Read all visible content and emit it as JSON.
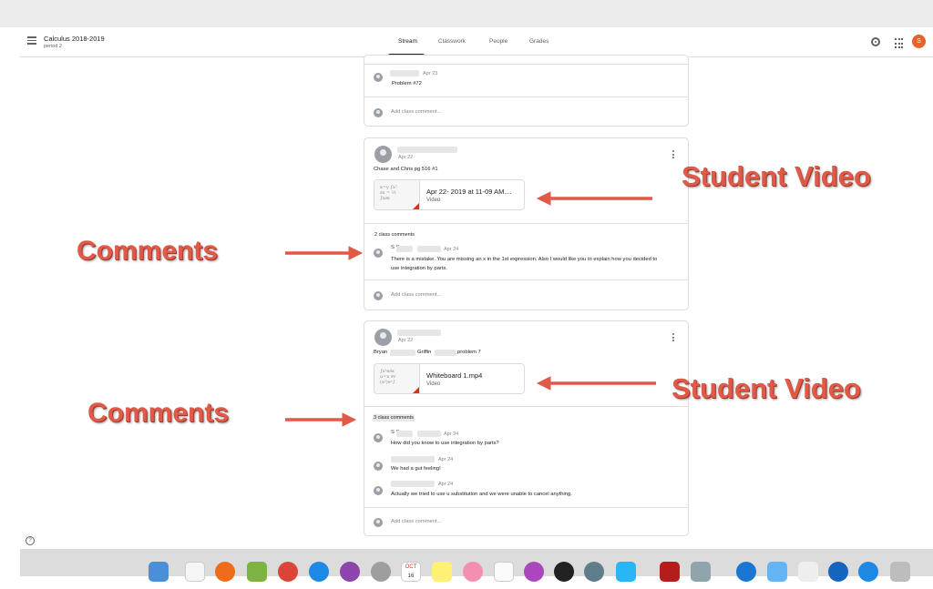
{
  "header": {
    "class_title": "Calculus 2018-2019",
    "class_subtitle": "period 2",
    "tabs": [
      {
        "label": "Stream",
        "active": true
      },
      {
        "label": "Classwork",
        "active": false
      },
      {
        "label": "People",
        "active": false
      },
      {
        "label": "Grades",
        "active": false
      }
    ],
    "avatar_letter": "S"
  },
  "card_top": {
    "comment_date": "Apr 23",
    "comment_text": "Problem #72",
    "add_comment_placeholder": "Add class comment..."
  },
  "post1": {
    "date": "Apr 22",
    "body": "Chase and Chris pg 516 #1",
    "attachment_title": "Apr 22- 2019 at 11-09 AM....",
    "attachment_type": "Video",
    "comment_count": "2 class comments",
    "comments": [
      {
        "author": "S          S",
        "date": "Apr 24",
        "text_line1": "There is a mistake. You are missing an x in the 1st expression. Also I would like you to explain how you decided to",
        "text_line2": "use integration by parts."
      }
    ],
    "add_comment_placeholder": "Add class comment..."
  },
  "post2": {
    "date": "Apr 22",
    "body_prefix": "Bryan",
    "body_middle": "Griffin",
    "body_suffix": "problem 7",
    "attachment_title": "Whiteboard 1.mp4",
    "attachment_type": "Video",
    "comment_count": "3 class comments",
    "comments": [
      {
        "author": "S          S",
        "date": "Apr 24",
        "text": "How did you know to use integration by parts?"
      },
      {
        "author": "",
        "date": "Apr 24",
        "text": "We had a gut feeling!"
      },
      {
        "author": "",
        "date": "Apr 24",
        "text": "Actually we tried to use u substitution and we were unable to cancel anything."
      }
    ],
    "add_comment_placeholder": "Add class comment..."
  },
  "annotations": {
    "student_video_1": "Student Video",
    "student_video_2": "Student Video",
    "comments_1": "Comments",
    "comments_2": "Comments",
    "annotation_color": "#e05a47"
  },
  "help_glyph": "?",
  "dock": {
    "calendar_month": "OCT",
    "calendar_day": "16"
  }
}
